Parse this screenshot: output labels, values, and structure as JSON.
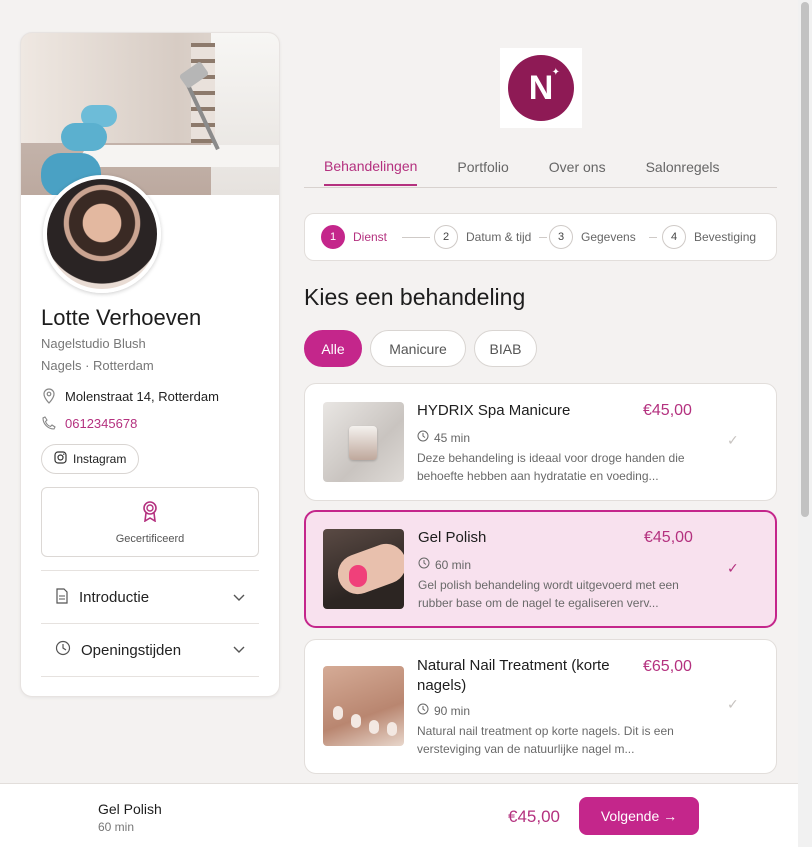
{
  "profile": {
    "name": "Lotte Verhoeven",
    "studio": "Nagelstudio Blush",
    "meta": "Nagels · Rotterdam",
    "address": "Molenstraat 14, Rotterdam",
    "phone": "0612345678",
    "instagram_label": "Instagram",
    "certified_label": "Gecertificeerd",
    "accordion": [
      {
        "label": "Introductie",
        "icon": "document-icon"
      },
      {
        "label": "Openingstijden",
        "icon": "clock-icon"
      }
    ]
  },
  "logo": {
    "letter": "N"
  },
  "tabs": [
    {
      "label": "Behandelingen",
      "active": true
    },
    {
      "label": "Portfolio",
      "active": false
    },
    {
      "label": "Over ons",
      "active": false
    },
    {
      "label": "Salonregels",
      "active": false
    }
  ],
  "stepper": [
    {
      "num": "1",
      "label": "Dienst",
      "active": true
    },
    {
      "num": "2",
      "label": "Datum & tijd",
      "active": false
    },
    {
      "num": "3",
      "label": "Gegevens",
      "active": false
    },
    {
      "num": "4",
      "label": "Bevestiging",
      "active": false
    }
  ],
  "heading": "Kies een behandeling",
  "filters": [
    {
      "label": "Alle",
      "active": true
    },
    {
      "label": "Manicure",
      "active": false
    },
    {
      "label": "BIAB",
      "active": false
    }
  ],
  "services": [
    {
      "title": "HYDRIX Spa Manicure",
      "price": "€45,00",
      "duration": "45 min",
      "description": "Deze behandeling is ideaal voor droge handen die behoefte hebben aan hydratatie en voeding...",
      "selected": false
    },
    {
      "title": "Gel Polish",
      "price": "€45,00",
      "duration": "60 min",
      "description": "Gel polish behandeling wordt uitgevoerd met een rubber base om de nagel te egaliseren verv...",
      "selected": true
    },
    {
      "title": "Natural Nail Treatment (korte nagels)",
      "price": "€65,00",
      "duration": "90 min",
      "description": "Natural nail treatment op korte nagels. Dit is een versteviging van de natuurlijke nagel m...",
      "selected": false
    }
  ],
  "footer": {
    "name": "Gel Polish",
    "duration": "60 min",
    "price": "€45,00",
    "button": "Volgende →"
  },
  "colors": {
    "accent": "#c4268b",
    "accent_text": "#b4317f",
    "selected_bg": "#f8e1ee",
    "logo_bg": "#8e1a55"
  }
}
